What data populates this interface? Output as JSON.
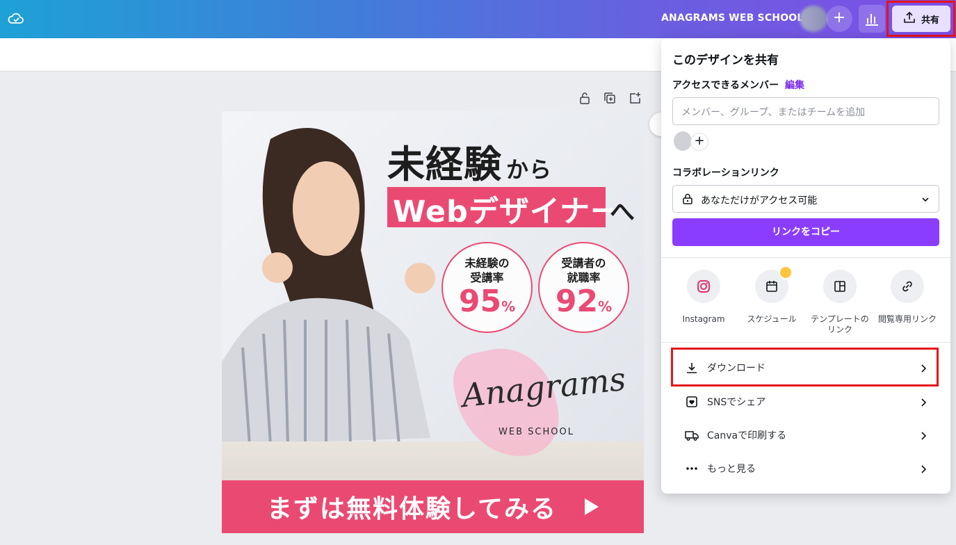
{
  "topbar": {
    "team_name": "ANAGRAMS WEB SCHOOL",
    "add_label": "+",
    "share_label": "共有"
  },
  "design": {
    "headline_main": "未経験",
    "headline_small": "から",
    "headline_pink": "Webデザイナー",
    "headline_suffix": "へ",
    "stats": [
      {
        "label_line1": "未経験の",
        "label_line2": "受講率",
        "value": "95",
        "unit": "%"
      },
      {
        "label_line1": "受講者の",
        "label_line2": "就職率",
        "value": "92",
        "unit": "%"
      }
    ],
    "logo_script": "Anagrams",
    "logo_sub": "WEB SCHOOL",
    "cta": "まずは無料体験してみる"
  },
  "share_panel": {
    "title": "このデザインを共有",
    "members_label": "アクセスできるメンバー",
    "edit_link": "編集",
    "member_placeholder": "メンバー、グループ、またはチームを追加",
    "add_member": "+",
    "collab_label": "コラボレーションリンク",
    "access_value": "あなただけがアクセス可能",
    "copy_button": "リンクをコピー",
    "options": [
      {
        "label_1": "Instagram",
        "label_2": "",
        "icon": "instagram-icon"
      },
      {
        "label_1": "スケジュール",
        "label_2": "",
        "icon": "calendar-icon"
      },
      {
        "label_1": "テンプレートの",
        "label_2": "リンク",
        "icon": "template-icon"
      },
      {
        "label_1": "閲覧専用リンク",
        "label_2": "",
        "icon": "link-icon"
      }
    ],
    "rows": [
      {
        "label": "ダウンロード",
        "icon": "download-icon"
      },
      {
        "label": "SNSでシェア",
        "icon": "heart-icon"
      },
      {
        "label": "Canvaで印刷する",
        "icon": "truck-icon"
      },
      {
        "label": "もっと見る",
        "icon": "more-icon"
      }
    ]
  },
  "colors": {
    "accent_purple": "#8b3dff",
    "brand_pink": "#ea4a72",
    "highlight_red": "#e4141c"
  }
}
